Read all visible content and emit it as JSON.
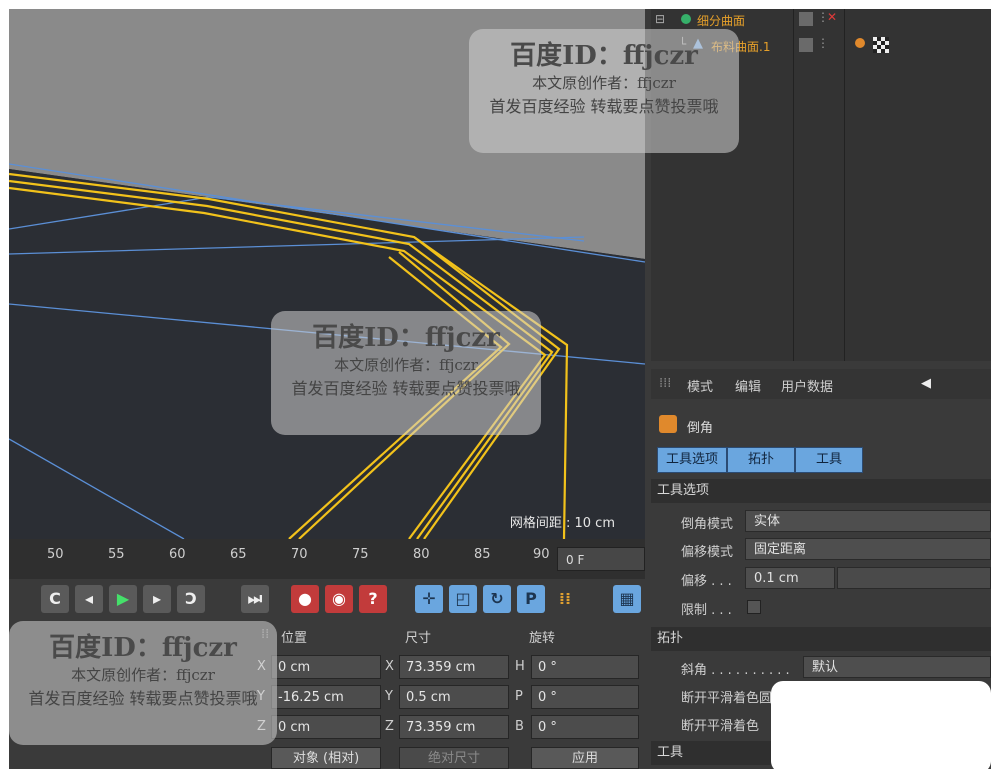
{
  "viewport": {
    "grid_label": "网格间距 : 10 cm"
  },
  "object_manager": {
    "items": [
      {
        "name": "细分曲面"
      },
      {
        "name": "布料曲面.1"
      }
    ]
  },
  "attribute_manager": {
    "menu": {
      "mode": "模式",
      "edit": "编辑",
      "user_data": "用户数据"
    },
    "object_title": "倒角",
    "tabs": [
      "工具选项",
      "拓扑",
      "工具"
    ],
    "sections": {
      "tool_options": "工具选项",
      "topology": "拓扑",
      "tool": "工具"
    },
    "props": {
      "bevel_mode_label": "倒角模式",
      "bevel_mode_value": "实体",
      "offset_mode_label": "偏移模式",
      "offset_mode_value": "固定距离",
      "offset_label": "偏移 . . .",
      "offset_value": "0.1 cm",
      "limit_label": "限制 . . .",
      "miter_label": "斜角 . . . . . . . . . .",
      "miter_value": "默认",
      "break_phong_1": "断开平滑着色圆角",
      "break_phong_2": "断开平滑着色"
    }
  },
  "timeline": {
    "ticks": [
      "50",
      "55",
      "60",
      "65",
      "70",
      "75",
      "80",
      "85",
      "90"
    ],
    "current_frame": "0 F"
  },
  "coordinates": {
    "headers": {
      "position": "位置",
      "size": "尺寸",
      "rotation": "旋转"
    },
    "rows": [
      {
        "axis": "X",
        "pos": "0 cm",
        "size_axis": "X",
        "size": "73.359 cm",
        "rot_axis": "H",
        "rot": "0 °"
      },
      {
        "axis": "Y",
        "pos": "-16.25 cm",
        "size_axis": "Y",
        "size": "0.5 cm",
        "rot_axis": "P",
        "rot": "0 °"
      },
      {
        "axis": "Z",
        "pos": "0 cm",
        "size_axis": "Z",
        "size": "73.359 cm",
        "rot_axis": "B",
        "rot": "0 °"
      }
    ],
    "mode_select": "对象 (相对)",
    "size_select": "绝对尺寸",
    "apply": "应用"
  },
  "watermark": {
    "line1": "百度ID：ffjczr",
    "line2": "本文原创作者：ffjczr",
    "line3": "首发百度经验 转载要点赞投票哦"
  },
  "colors": {
    "accent_blue": "#6aa6df",
    "spline_yellow": "#f2c21b",
    "grid_blue": "#5b8fd6"
  }
}
